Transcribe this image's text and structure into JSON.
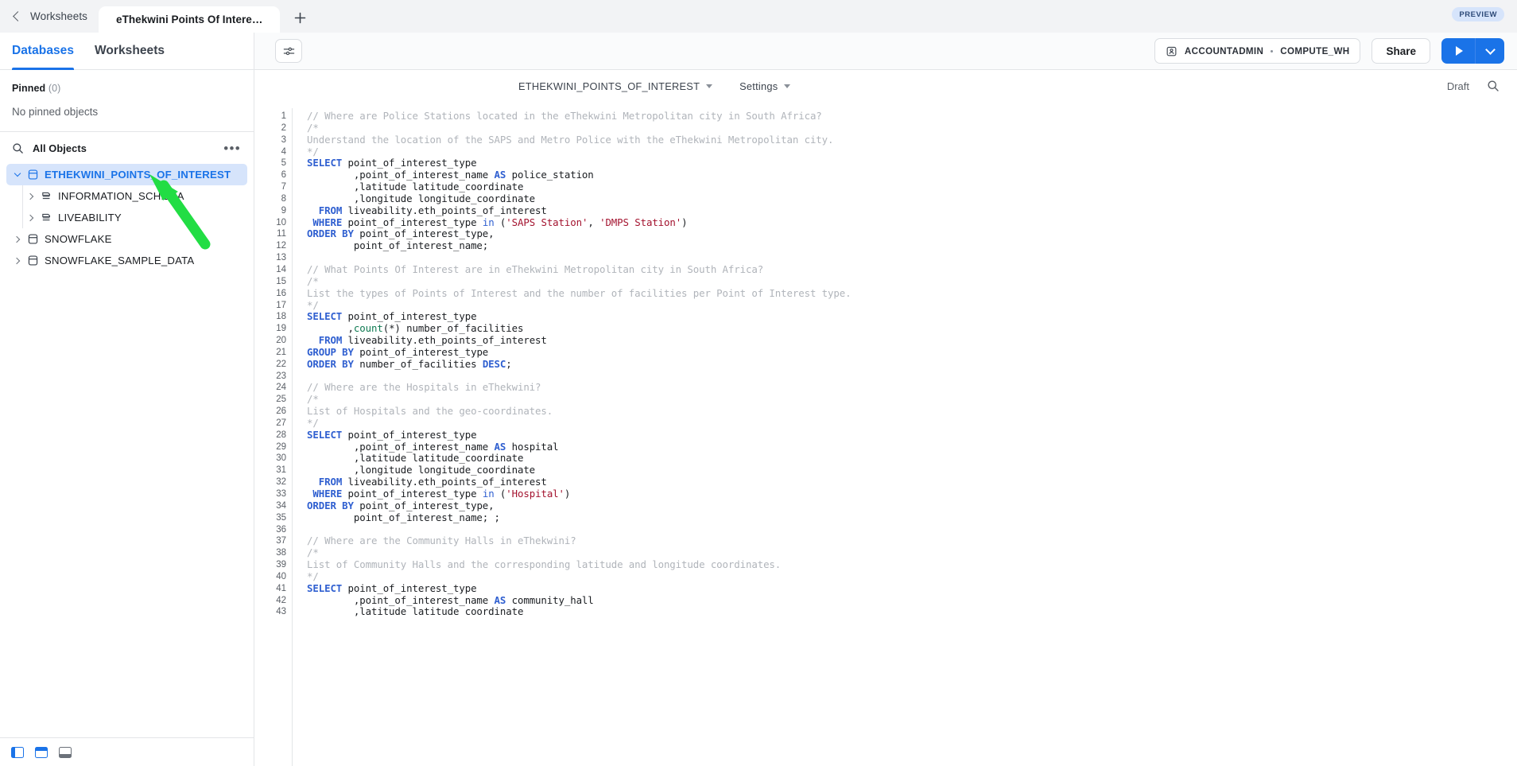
{
  "window": {
    "back_label": "Worksheets",
    "active_tab": "eThekwini Points Of Intere…",
    "new_tab_icon": "plus-icon",
    "preview_badge": "PREVIEW"
  },
  "sidebar": {
    "tabs": [
      {
        "label": "Databases",
        "active": true
      },
      {
        "label": "Worksheets",
        "active": false
      }
    ],
    "pinned": {
      "title": "Pinned",
      "count": "(0)",
      "empty_text": "No pinned objects"
    },
    "objects": {
      "search_icon": "search-icon",
      "label": "All Objects",
      "more_icon": "ellipsis-icon"
    },
    "tree": [
      {
        "label": "ETHEKWINI_POINTS_OF_INTEREST",
        "icon": "database-icon",
        "level": 0,
        "expanded": true,
        "selected": true
      },
      {
        "label": "INFORMATION_SCHEMA",
        "icon": "schema-icon",
        "level": 1,
        "expanded": false,
        "selected": false
      },
      {
        "label": "LIVEABILITY",
        "icon": "schema-icon",
        "level": 1,
        "expanded": false,
        "selected": false
      },
      {
        "label": "SNOWFLAKE",
        "icon": "database-icon",
        "level": 0,
        "expanded": false,
        "selected": false
      },
      {
        "label": "SNOWFLAKE_SAMPLE_DATA",
        "icon": "database-icon",
        "level": 0,
        "expanded": false,
        "selected": false
      }
    ]
  },
  "toolbar": {
    "filter_icon": "sliders-icon",
    "role": "ACCOUNTADMIN",
    "warehouse": "COMPUTE_WH",
    "role_icon": "user-badge-icon",
    "share_label": "Share",
    "run_icon": "play-icon",
    "run_caret_icon": "chevron-down-icon"
  },
  "worksheet": {
    "context_label": "ETHEKWINI_POINTS_OF_INTEREST",
    "context_caret": "caret-down-icon",
    "settings_label": "Settings",
    "settings_caret": "caret-down-icon",
    "status": "Draft",
    "search_icon": "search-icon"
  },
  "statusbar": {
    "panels": [
      {
        "icon": "panel-left-icon",
        "state": "active"
      },
      {
        "icon": "panel-top-icon",
        "state": "active"
      },
      {
        "icon": "panel-bottom-icon",
        "state": "inactive"
      }
    ]
  },
  "colors": {
    "accent": "#1a73e8",
    "keyword": "#2f5fd0",
    "string": "#a3122e",
    "function": "#0f7a52",
    "comment": "#b0b4ba",
    "annotation_arrow": "#22dd44"
  },
  "editor": {
    "first_line": 1,
    "lines": [
      {
        "n": 1,
        "tokens": [
          {
            "t": "// Where are Police Stations located in the eThekwini Metropolitan city in South Africa?",
            "c": "cmt"
          }
        ]
      },
      {
        "n": 2,
        "tokens": [
          {
            "t": "/*",
            "c": "cmt"
          }
        ]
      },
      {
        "n": 3,
        "tokens": [
          {
            "t": "Understand the location of the SAPS and Metro Police with the eThekwini Metropolitan city.",
            "c": "cmt"
          }
        ]
      },
      {
        "n": 4,
        "tokens": [
          {
            "t": "*/",
            "c": "cmt"
          }
        ]
      },
      {
        "n": 5,
        "tokens": [
          {
            "t": "SELECT",
            "c": "kw"
          },
          {
            "t": " point_of_interest_type",
            "c": ""
          }
        ]
      },
      {
        "n": 6,
        "tokens": [
          {
            "t": "        ,point_of_interest_name ",
            "c": ""
          },
          {
            "t": "AS",
            "c": "kw"
          },
          {
            "t": " police_station",
            "c": ""
          }
        ]
      },
      {
        "n": 7,
        "tokens": [
          {
            "t": "        ,latitude latitude_coordinate",
            "c": ""
          }
        ]
      },
      {
        "n": 8,
        "tokens": [
          {
            "t": "        ,longitude longitude_coordinate",
            "c": ""
          }
        ]
      },
      {
        "n": 9,
        "tokens": [
          {
            "t": "  ",
            "c": ""
          },
          {
            "t": "FROM",
            "c": "kw"
          },
          {
            "t": " liveability.eth_points_of_interest",
            "c": ""
          }
        ]
      },
      {
        "n": 10,
        "tokens": [
          {
            "t": " ",
            "c": ""
          },
          {
            "t": "WHERE",
            "c": "kw"
          },
          {
            "t": " point_of_interest_type ",
            "c": ""
          },
          {
            "t": "in",
            "c": "kw2"
          },
          {
            "t": " (",
            "c": ""
          },
          {
            "t": "'SAPS Station'",
            "c": "str"
          },
          {
            "t": ", ",
            "c": ""
          },
          {
            "t": "'DMPS Station'",
            "c": "str"
          },
          {
            "t": ")",
            "c": ""
          }
        ]
      },
      {
        "n": 11,
        "tokens": [
          {
            "t": "ORDER BY",
            "c": "kw"
          },
          {
            "t": " point_of_interest_type,",
            "c": ""
          }
        ]
      },
      {
        "n": 12,
        "tokens": [
          {
            "t": "        point_of_interest_name;",
            "c": ""
          }
        ]
      },
      {
        "n": 13,
        "tokens": []
      },
      {
        "n": 14,
        "tokens": [
          {
            "t": "// What Points Of Interest are in eThekwini Metropolitan city in South Africa?",
            "c": "cmt"
          }
        ]
      },
      {
        "n": 15,
        "tokens": [
          {
            "t": "/*",
            "c": "cmt"
          }
        ]
      },
      {
        "n": 16,
        "tokens": [
          {
            "t": "List the types of Points of Interest and the number of facilities per Point of Interest type.",
            "c": "cmt"
          }
        ]
      },
      {
        "n": 17,
        "tokens": [
          {
            "t": "*/",
            "c": "cmt"
          }
        ]
      },
      {
        "n": 18,
        "tokens": [
          {
            "t": "SELECT",
            "c": "kw"
          },
          {
            "t": " point_of_interest_type",
            "c": ""
          }
        ]
      },
      {
        "n": 19,
        "tokens": [
          {
            "t": "       ,",
            "c": ""
          },
          {
            "t": "count",
            "c": "fn"
          },
          {
            "t": "(*) number_of_facilities",
            "c": ""
          }
        ]
      },
      {
        "n": 20,
        "tokens": [
          {
            "t": "  ",
            "c": ""
          },
          {
            "t": "FROM",
            "c": "kw"
          },
          {
            "t": " liveability.eth_points_of_interest",
            "c": ""
          }
        ]
      },
      {
        "n": 21,
        "tokens": [
          {
            "t": "GROUP BY",
            "c": "kw"
          },
          {
            "t": " point_of_interest_type",
            "c": ""
          }
        ]
      },
      {
        "n": 22,
        "tokens": [
          {
            "t": "ORDER BY",
            "c": "kw"
          },
          {
            "t": " number_of_facilities ",
            "c": ""
          },
          {
            "t": "DESC",
            "c": "kw"
          },
          {
            "t": ";",
            "c": ""
          }
        ]
      },
      {
        "n": 23,
        "tokens": []
      },
      {
        "n": 24,
        "tokens": [
          {
            "t": "// Where are the Hospitals in eThekwini?",
            "c": "cmt"
          }
        ]
      },
      {
        "n": 25,
        "tokens": [
          {
            "t": "/*",
            "c": "cmt"
          }
        ]
      },
      {
        "n": 26,
        "tokens": [
          {
            "t": "List of Hospitals and the geo-coordinates.",
            "c": "cmt"
          }
        ]
      },
      {
        "n": 27,
        "tokens": [
          {
            "t": "*/",
            "c": "cmt"
          }
        ]
      },
      {
        "n": 28,
        "tokens": [
          {
            "t": "SELECT",
            "c": "kw"
          },
          {
            "t": " point_of_interest_type",
            "c": ""
          }
        ]
      },
      {
        "n": 29,
        "tokens": [
          {
            "t": "        ,point_of_interest_name ",
            "c": ""
          },
          {
            "t": "AS",
            "c": "kw"
          },
          {
            "t": " hospital",
            "c": ""
          }
        ]
      },
      {
        "n": 30,
        "tokens": [
          {
            "t": "        ,latitude latitude_coordinate",
            "c": ""
          }
        ]
      },
      {
        "n": 31,
        "tokens": [
          {
            "t": "        ,longitude longitude_coordinate",
            "c": ""
          }
        ]
      },
      {
        "n": 32,
        "tokens": [
          {
            "t": "  ",
            "c": ""
          },
          {
            "t": "FROM",
            "c": "kw"
          },
          {
            "t": " liveability.eth_points_of_interest",
            "c": ""
          }
        ]
      },
      {
        "n": 33,
        "tokens": [
          {
            "t": " ",
            "c": ""
          },
          {
            "t": "WHERE",
            "c": "kw"
          },
          {
            "t": " point_of_interest_type ",
            "c": ""
          },
          {
            "t": "in",
            "c": "kw2"
          },
          {
            "t": " (",
            "c": ""
          },
          {
            "t": "'Hospital'",
            "c": "str"
          },
          {
            "t": ")",
            "c": ""
          }
        ]
      },
      {
        "n": 34,
        "tokens": [
          {
            "t": "ORDER BY",
            "c": "kw"
          },
          {
            "t": " point_of_interest_type,",
            "c": ""
          }
        ]
      },
      {
        "n": 35,
        "tokens": [
          {
            "t": "        point_of_interest_name; ;",
            "c": ""
          }
        ]
      },
      {
        "n": 36,
        "tokens": []
      },
      {
        "n": 37,
        "tokens": [
          {
            "t": "// Where are the Community Halls in eThekwini?",
            "c": "cmt"
          }
        ]
      },
      {
        "n": 38,
        "tokens": [
          {
            "t": "/*",
            "c": "cmt"
          }
        ]
      },
      {
        "n": 39,
        "tokens": [
          {
            "t": "List of Community Halls and the corresponding latitude and longitude coordinates.",
            "c": "cmt"
          }
        ]
      },
      {
        "n": 40,
        "tokens": [
          {
            "t": "*/",
            "c": "cmt"
          }
        ]
      },
      {
        "n": 41,
        "tokens": [
          {
            "t": "SELECT",
            "c": "kw"
          },
          {
            "t": " point_of_interest_type",
            "c": ""
          }
        ]
      },
      {
        "n": 42,
        "tokens": [
          {
            "t": "        ,point_of_interest_name ",
            "c": ""
          },
          {
            "t": "AS",
            "c": "kw"
          },
          {
            "t": " community_hall",
            "c": ""
          }
        ]
      },
      {
        "n": 43,
        "tokens": [
          {
            "t": "        ,latitude latitude coordinate",
            "c": ""
          }
        ]
      }
    ]
  }
}
